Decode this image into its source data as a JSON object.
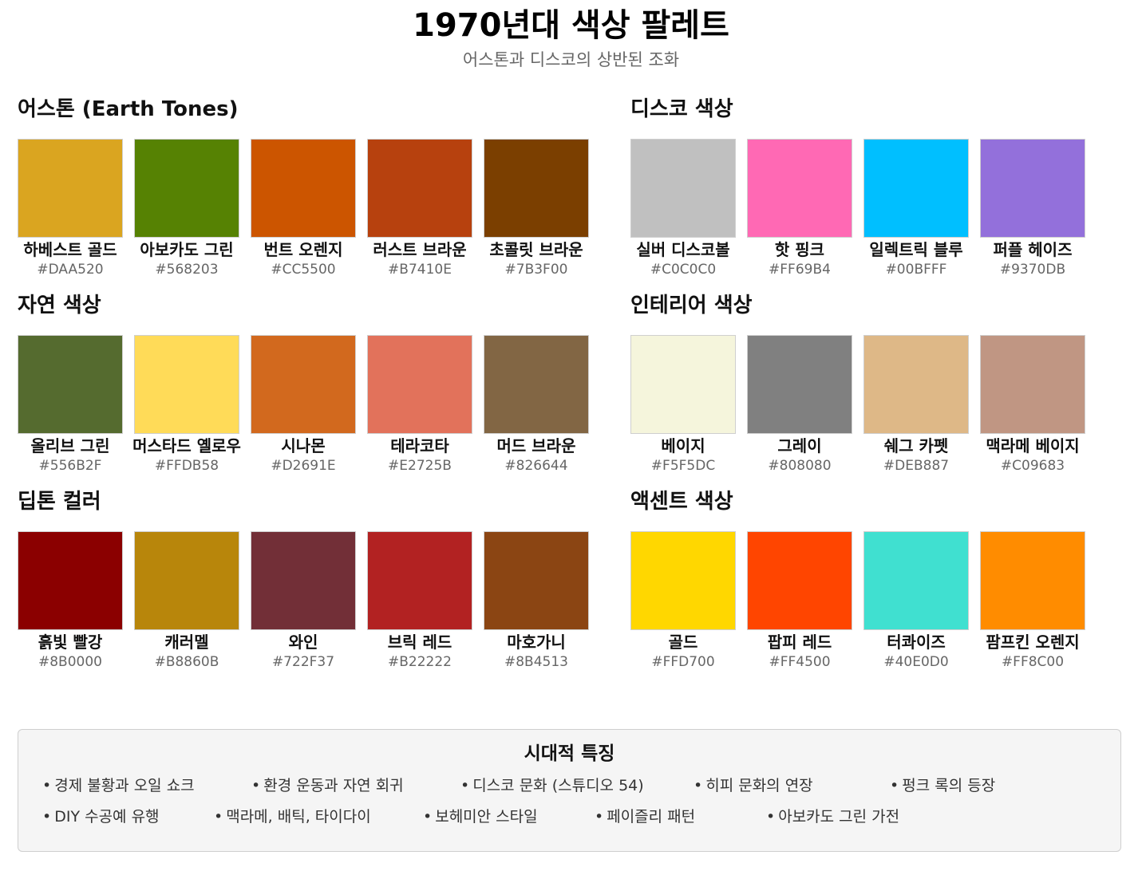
{
  "header": {
    "title": "1970년대 색상 팔레트",
    "subtitle": "어스톤과 디스코의 상반된 조화"
  },
  "sections": [
    {
      "title": "어스톤 (Earth Tones)",
      "swatches": [
        {
          "name": "하베스트 골드",
          "hex": "#DAA520",
          "color": "#DAA520"
        },
        {
          "name": "아보카도 그린",
          "hex": "#568203",
          "color": "#568203"
        },
        {
          "name": "번트 오렌지",
          "hex": "#CC5500",
          "color": "#CC5500"
        },
        {
          "name": "러스트 브라운",
          "hex": "#B7410E",
          "color": "#B7410E"
        },
        {
          "name": "초콜릿 브라운",
          "hex": "#7B3F00",
          "color": "#7B3F00"
        }
      ]
    },
    {
      "title": "디스코 색상",
      "swatches": [
        {
          "name": "실버 디스코볼",
          "hex": "#C0C0C0",
          "color": "#C0C0C0"
        },
        {
          "name": "핫 핑크",
          "hex": "#FF69B4",
          "color": "#FF69B4"
        },
        {
          "name": "일렉트릭 블루",
          "hex": "#00BFFF",
          "color": "#00BFFF"
        },
        {
          "name": "퍼플 헤이즈",
          "hex": "#9370DB",
          "color": "#9370DB"
        }
      ]
    },
    {
      "title": "자연 색상",
      "swatches": [
        {
          "name": "올리브 그린",
          "hex": "#556B2F",
          "color": "#556B2F"
        },
        {
          "name": "머스타드 옐로우",
          "hex": "#FFDB58",
          "color": "#FFDB58"
        },
        {
          "name": "시나몬",
          "hex": "#D2691E",
          "color": "#D2691E"
        },
        {
          "name": "테라코타",
          "hex": "#E2725B",
          "color": "#E2725B"
        },
        {
          "name": "머드 브라운",
          "hex": "#826644",
          "color": "#826644"
        }
      ]
    },
    {
      "title": "인테리어 색상",
      "swatches": [
        {
          "name": "베이지",
          "hex": "#F5F5DC",
          "color": "#F5F5DC"
        },
        {
          "name": "그레이",
          "hex": "#808080",
          "color": "#808080"
        },
        {
          "name": "쉐그 카펫",
          "hex": "#DEB887",
          "color": "#DEB887"
        },
        {
          "name": "맥라메 베이지",
          "hex": "#C09683",
          "color": "#C09683"
        }
      ]
    },
    {
      "title": "딥톤 컬러",
      "swatches": [
        {
          "name": "흙빛 빨강",
          "hex": "#8B0000",
          "color": "#8B0000"
        },
        {
          "name": "캐러멜",
          "hex": "#B8860B",
          "color": "#B8860B"
        },
        {
          "name": "와인",
          "hex": "#722F37",
          "color": "#722F37"
        },
        {
          "name": "브릭 레드",
          "hex": "#B22222",
          "color": "#B22222"
        },
        {
          "name": "마호가니",
          "hex": "#8B4513",
          "color": "#8B4513"
        }
      ]
    },
    {
      "title": "액센트 색상",
      "swatches": [
        {
          "name": "골드",
          "hex": "#FFD700",
          "color": "#FFD700"
        },
        {
          "name": "팝피 레드",
          "hex": "#FF4500",
          "color": "#FF4500"
        },
        {
          "name": "터콰이즈",
          "hex": "#40E0D0",
          "color": "#40E0D0"
        },
        {
          "name": "팜프킨 오렌지",
          "hex": "#FF8C00",
          "color": "#FF8C00"
        }
      ]
    }
  ],
  "features": {
    "title": "시대적 특징",
    "row1": [
      "경제 불황과 오일 쇼크",
      "환경 운동과 자연 회귀",
      "디스코 문화 (스튜디오 54)",
      "히피 문화의 연장",
      "펑크 록의 등장"
    ],
    "row2": [
      "DIY 수공예 유행",
      "맥라메, 배틱, 타이다이",
      "보헤미안 스타일",
      "페이즐리 패턴",
      "아보카도 그린 가전"
    ]
  }
}
